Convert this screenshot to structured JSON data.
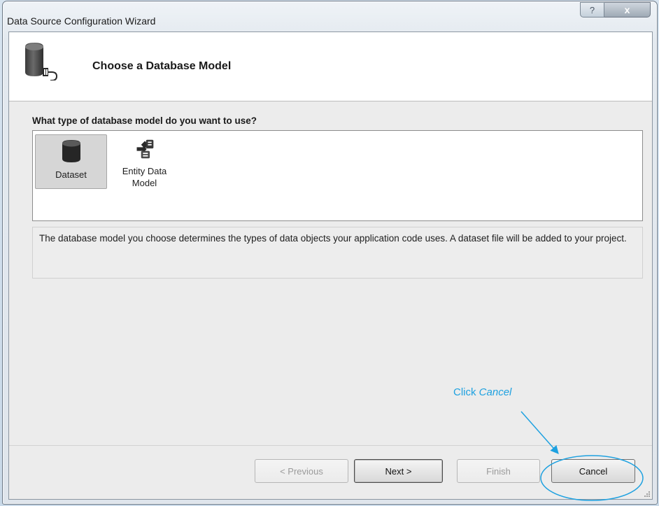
{
  "window": {
    "title": "Data Source Configuration Wizard",
    "help_glyph": "?",
    "close_glyph": "x"
  },
  "header": {
    "title": "Choose a Database Model",
    "icon": "database-connect-icon"
  },
  "question": "What type of database model do you want to use?",
  "models": [
    {
      "label": "Dataset",
      "icon": "database-icon",
      "selected": true
    },
    {
      "label": "Entity Data Model",
      "icon": "entity-data-model-icon",
      "selected": false
    }
  ],
  "description": "The database model you choose determines the types of data objects your application code uses. A dataset file will be added to your project.",
  "buttons": {
    "previous": "< Previous",
    "next": "Next >",
    "finish": "Finish",
    "cancel": "Cancel"
  },
  "annotation": {
    "prefix": "Click ",
    "emphasis": "Cancel",
    "color": "#1ea1e0"
  }
}
